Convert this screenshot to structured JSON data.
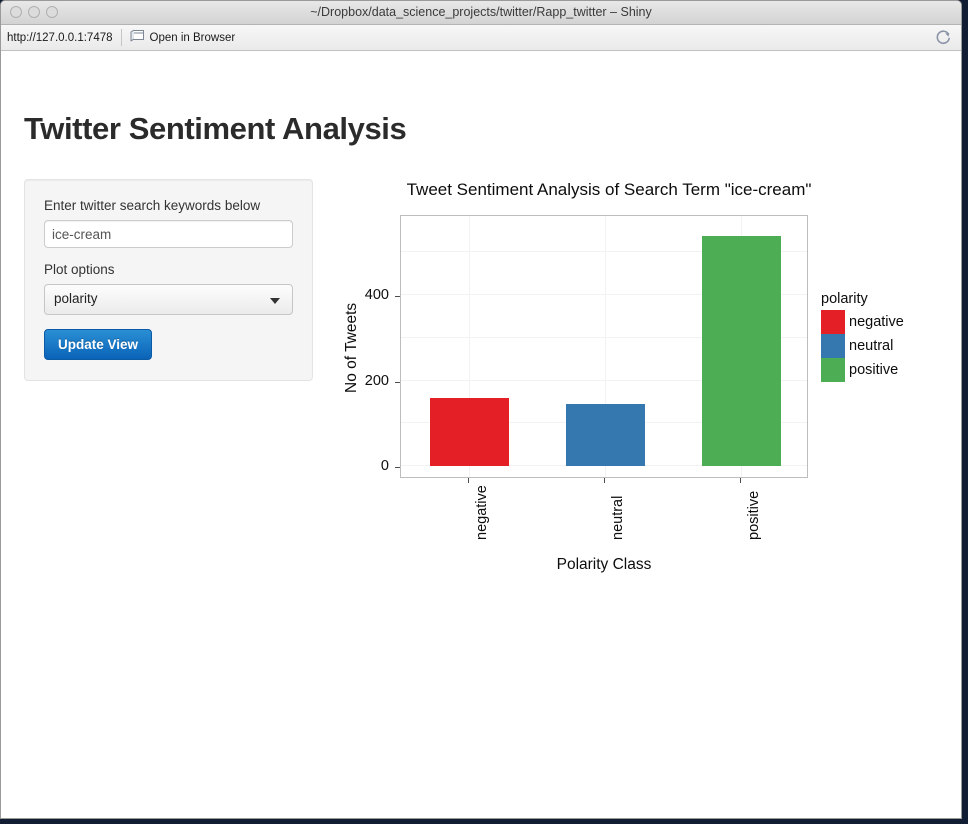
{
  "window": {
    "title": "~/Dropbox/data_science_projects/twitter/Rapp_twitter – Shiny",
    "traffic_lights": [
      "close-button",
      "minimize-button",
      "zoom-button"
    ]
  },
  "toolbar": {
    "url": "http://127.0.0.1:7478",
    "open_in_browser_label": "Open in Browser",
    "open_in_browser_icon": "browser-window-icon",
    "reload_icon": "reload-icon"
  },
  "page": {
    "title": "Twitter Sentiment Analysis"
  },
  "sidebar": {
    "keyword_label": "Enter twitter search keywords below",
    "keyword_value": "ice-cream",
    "keyword_placeholder": "ice-cream",
    "plot_options_label": "Plot options",
    "plot_select_value": "polarity",
    "plot_select_options": [
      "polarity"
    ],
    "update_button_label": "Update View"
  },
  "chart_data": {
    "type": "bar",
    "title": "Tweet Sentiment Analysis of Search Term \"ice-cream\"",
    "xlabel": "Polarity Class",
    "ylabel": "No of Tweets",
    "categories": [
      "negative",
      "neutral",
      "positive"
    ],
    "values": [
      160,
      146,
      539
    ],
    "colors": [
      "#e41f26",
      "#3478af",
      "#4cad55"
    ],
    "ylim": [
      0,
      590
    ],
    "yticks": [
      0,
      200,
      400
    ],
    "ytick_labels": [
      "0",
      "200",
      "400"
    ],
    "grid": true,
    "legend": {
      "title": "polarity",
      "position": "right",
      "entries": [
        {
          "label": "negative",
          "color": "#e41f26"
        },
        {
          "label": "neutral",
          "color": "#3478af"
        },
        {
          "label": "positive",
          "color": "#4cad55"
        }
      ]
    }
  }
}
